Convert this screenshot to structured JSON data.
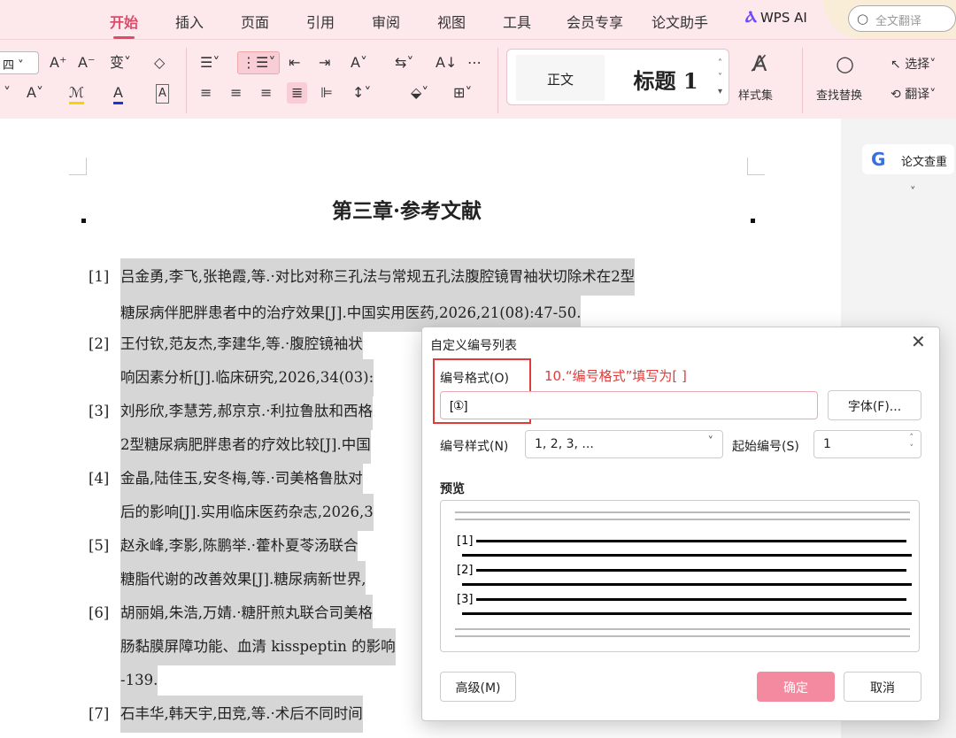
{
  "tabs": [
    "开始",
    "插入",
    "页面",
    "引用",
    "审阅",
    "视图",
    "工具",
    "会员专享",
    "论文助手"
  ],
  "wps_ai": "WPS AI",
  "search": {
    "placeholder": "全文翻译"
  },
  "ribbon": {
    "font_size": "四",
    "style_normal": "正文",
    "style_h1": "标题 1",
    "style_set": "样式集",
    "find_replace": "查找替换",
    "select": "选择",
    "translate": "翻译"
  },
  "sidebar": {
    "check_label": "论文查重"
  },
  "doc": {
    "title": "第三章·参考文献",
    "refs": [
      {
        "num": "[1]",
        "line1": "吕金勇,李飞,张艳霞,等.·对比对称三孔法与常规五孔法腹腔镜胃袖状切除术在2型",
        "line2": "糖尿病伴肥胖患者中的治疗效果[J].中国实用医药,2026,21(08):47-50."
      },
      {
        "num": "[2]",
        "line1": "王付钦,范友杰,李建华,等.·腹腔镜袖状",
        "line2": "响因素分析[J].临床研究,2026,34(03):"
      },
      {
        "num": "[3]",
        "line1": "刘彤欣,李慧芳,郝京京.·利拉鲁肽和西格",
        "line2": "2型糖尿病肥胖患者的疗效比较[J].中国"
      },
      {
        "num": "[4]",
        "line1": "金晶,陆佳玉,安冬梅,等.·司美格鲁肽对",
        "line2": "后的影响[J].实用临床医药杂志,2026,3"
      },
      {
        "num": "[5]",
        "line1": "赵永峰,李影,陈鹏举.·藿朴夏苓汤联合",
        "line2": "糖脂代谢的改善效果[J].糖尿病新世界,"
      },
      {
        "num": "[6]",
        "line1": "胡丽娟,朱浩,万婧.·糖肝煎丸联合司美格",
        "line2": "肠黏膜屏障功能、血清 kisspeptin 的影响"
      },
      {
        "num": "",
        "line1": "-139.",
        "line2": ""
      },
      {
        "num": "[7]",
        "line1": "石丰华,韩天宇,田竞,等.·术后不同时间",
        "line2": ""
      }
    ]
  },
  "dialog": {
    "title": "自定义编号列表",
    "annotation": "10.“编号格式”填写为[ ]",
    "format_label": "编号格式(O)",
    "format_value": "[①]",
    "font_button": "字体(F)...",
    "style_label": "编号样式(N)",
    "style_value": "1, 2, 3, ...",
    "start_label": "起始编号(S)",
    "start_value": "1",
    "preview_label": "预览",
    "preview_nums": [
      "[1]",
      "[2]",
      "[3]"
    ],
    "advanced_button": "高级(M)",
    "ok_button": "确定",
    "cancel_button": "取消"
  }
}
